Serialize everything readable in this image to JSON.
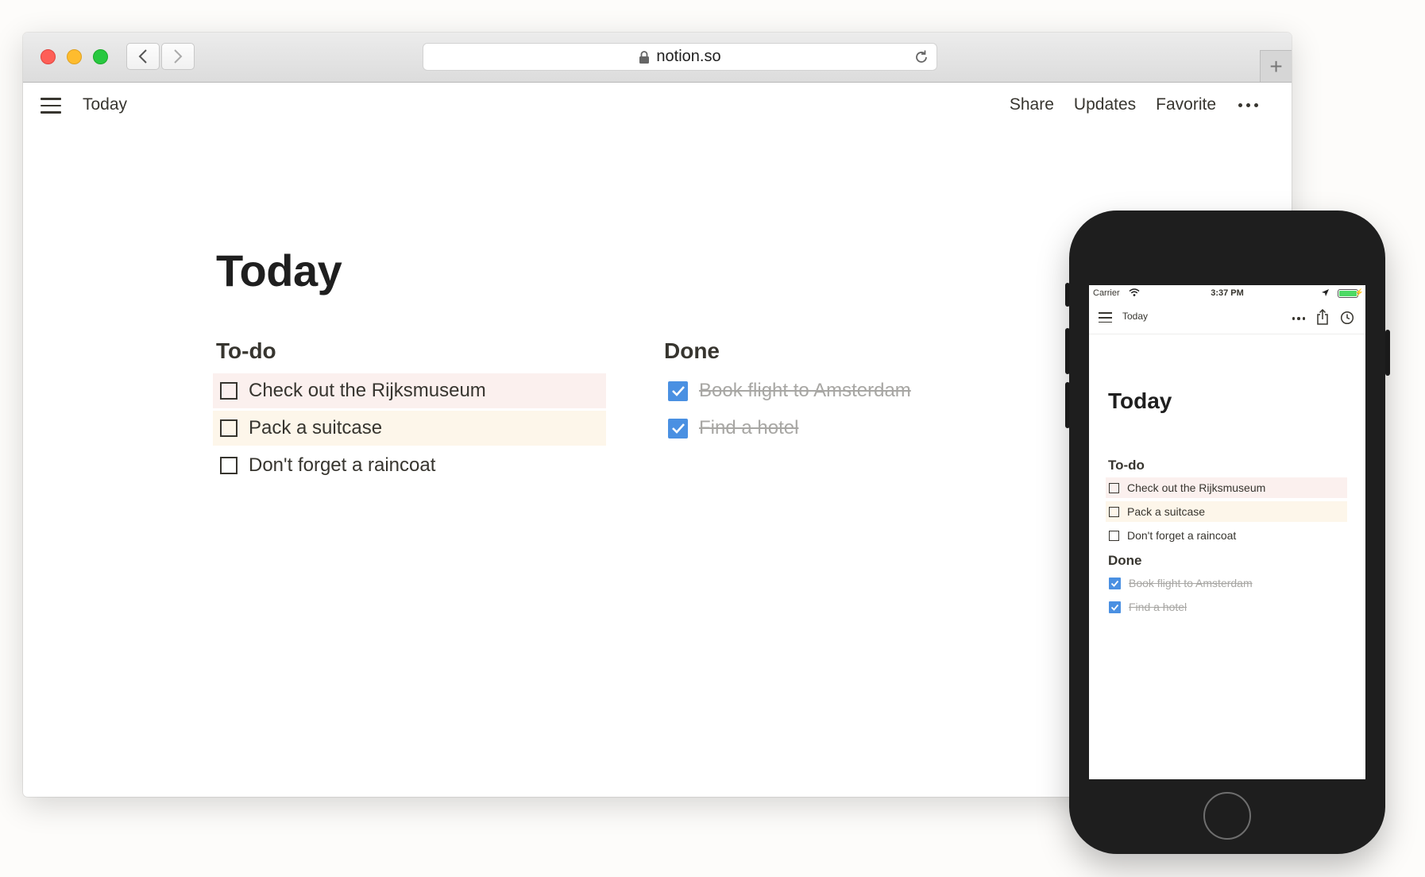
{
  "browser": {
    "url": "notion.so",
    "new_tab_label": "+"
  },
  "desktop": {
    "breadcrumb": "Today",
    "actions": {
      "share": "Share",
      "updates": "Updates",
      "favorite": "Favorite"
    },
    "title": "Today",
    "todo_heading": "To-do",
    "done_heading": "Done",
    "todo_items": [
      {
        "label": "Check out the Rijksmuseum",
        "highlight": "#fbf0ee"
      },
      {
        "label": "Pack a suitcase",
        "highlight": "#fdf6ea"
      },
      {
        "label": "Don't forget a raincoat",
        "highlight": ""
      }
    ],
    "done_items": [
      {
        "label": "Book flight to Amsterdam",
        "checked": true
      },
      {
        "label": "Find a hotel",
        "checked": true
      }
    ]
  },
  "mobile": {
    "carrier": "Carrier",
    "time": "3:37 PM",
    "battery_level": 1.0,
    "breadcrumb": "Today",
    "title": "Today",
    "todo_heading": "To-do",
    "done_heading": "Done",
    "todo_items": [
      {
        "label": "Check out the Rijksmuseum"
      },
      {
        "label": "Pack a suitcase"
      },
      {
        "label": "Don't forget a raincoat"
      }
    ],
    "done_items": [
      {
        "label": "Book flight to Amsterdam",
        "checked": true
      },
      {
        "label": "Find a hotel",
        "checked": true
      }
    ]
  },
  "colors": {
    "checkbox_checked": "#4a90e2",
    "highlight_pink": "#fbf0ee",
    "highlight_cream": "#fdf6ea",
    "done_text": "#a8a7a4"
  }
}
